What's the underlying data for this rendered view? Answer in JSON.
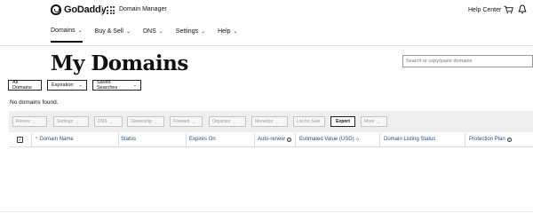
{
  "header": {
    "logo_text": "GoDaddy",
    "product_name": "Domain Manager",
    "help_center": "Help Center",
    "icons": [
      "godaddy-logo-icon",
      "apps-grid-icon",
      "cart-icon",
      "bell-icon"
    ]
  },
  "nav": {
    "items": [
      {
        "label": "Domains",
        "active": true
      },
      {
        "label": "Buy & Sell",
        "active": false
      },
      {
        "label": "DNS",
        "active": false
      },
      {
        "label": "Settings",
        "active": false
      },
      {
        "label": "Help",
        "active": false
      }
    ]
  },
  "page": {
    "title": "My Domains",
    "search_placeholder": "Search or copy/paste domains"
  },
  "filters": {
    "all_domains": "All Domains",
    "expiration": "Expiration",
    "saved_searches": "Saved Searches"
  },
  "status_message": "No domains found.",
  "toolbar": {
    "buttons": [
      {
        "label": "Renew",
        "enabled": false
      },
      {
        "label": "Settings",
        "enabled": false
      },
      {
        "label": "DNS",
        "enabled": false
      },
      {
        "label": "Ownership",
        "enabled": false
      },
      {
        "label": "Forward",
        "enabled": false
      },
      {
        "label": "Organize",
        "enabled": false
      },
      {
        "label": "Monetize",
        "enabled": false
      },
      {
        "label": "List for Sale",
        "enabled": false
      },
      {
        "label": "Export",
        "enabled": true
      },
      {
        "label": "More",
        "enabled": false
      }
    ]
  },
  "table": {
    "columns": [
      {
        "label": "Domain Name"
      },
      {
        "label": "Status"
      },
      {
        "label": "Expires On"
      },
      {
        "label": "Auto-renew"
      },
      {
        "label": "Estimated Value (USD)"
      },
      {
        "label": "Domain Listing Status"
      },
      {
        "label": "Protection Plan"
      }
    ]
  },
  "colors": {
    "column_header_text": "#1a4f86",
    "toolbar_bg": "#efefef",
    "disabled_text": "#999999"
  }
}
